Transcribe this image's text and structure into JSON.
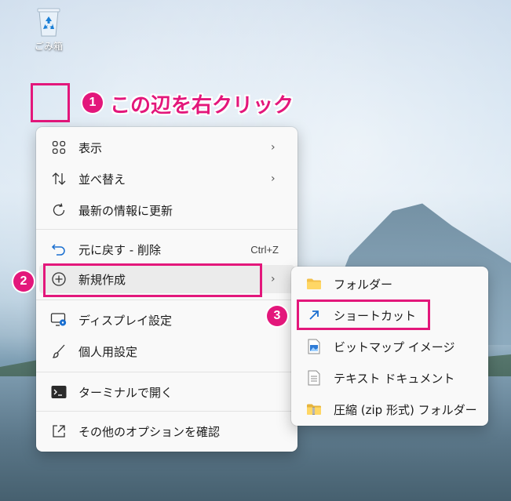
{
  "desktop": {
    "recycle_bin_label": "ごみ箱"
  },
  "annotations": {
    "step1": "1",
    "step2": "2",
    "step3": "3",
    "callout": "この辺を右クリック",
    "color": "#e3177b"
  },
  "context_menu": {
    "items": [
      {
        "label": "表示",
        "icon": "grid-icon",
        "submenu": true
      },
      {
        "label": "並べ替え",
        "icon": "sort-icon",
        "submenu": true
      },
      {
        "label": "最新の情報に更新",
        "icon": "refresh-icon",
        "submenu": false
      },
      {
        "label": "元に戻す - 削除",
        "icon": "undo-icon",
        "shortcut": "Ctrl+Z"
      },
      {
        "label": "新規作成",
        "icon": "new-plus-icon",
        "submenu": true
      },
      {
        "label": "ディスプレイ設定",
        "icon": "display-settings-icon"
      },
      {
        "label": "個人用設定",
        "icon": "brush-icon"
      },
      {
        "label": "ターミナルで開く",
        "icon": "terminal-icon"
      },
      {
        "label": "その他のオプションを確認",
        "icon": "more-options-icon"
      }
    ]
  },
  "new_submenu": {
    "items": [
      {
        "label": "フォルダー",
        "icon": "folder-icon"
      },
      {
        "label": "ショートカット",
        "icon": "shortcut-icon"
      },
      {
        "label": "ビットマップ イメージ",
        "icon": "bitmap-icon"
      },
      {
        "label": "テキスト ドキュメント",
        "icon": "text-document-icon"
      },
      {
        "label": "圧縮 (zip 形式) フォルダー",
        "icon": "zip-folder-icon"
      }
    ]
  }
}
